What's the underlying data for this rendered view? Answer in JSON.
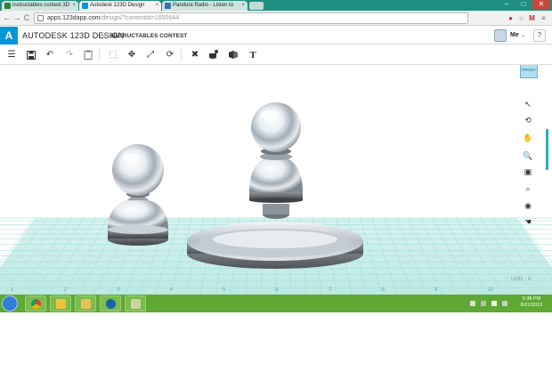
{
  "browser": {
    "tabs": [
      {
        "label": "instructables contest 3D",
        "active": false,
        "favicon_color": "#2d7f3b"
      },
      {
        "label": "Autodesk 123D Design",
        "active": true,
        "favicon_color": "#0696d7"
      },
      {
        "label": "Pandora Radio - Listen to",
        "active": false,
        "favicon_color": "#3a6fb5"
      }
    ],
    "tab_close": "×",
    "window_buttons": {
      "minimize": "–",
      "maximize": "□",
      "close": "✕"
    },
    "url_host": "apps.123dapp.com",
    "url_path": "/design/?contentId=1650644",
    "nav": {
      "back": "←",
      "forward": "→",
      "reload": "C"
    }
  },
  "app": {
    "logo_letter": "A",
    "brand_prefix": "AUTODESK",
    "brand_suffix": "123D",
    "brand_word": "DESIGN",
    "separator": "\\",
    "project_name": "INSTRUCTABLES CONTEST",
    "user_label": "Me",
    "user_caret": "⌄",
    "help_label": "?"
  },
  "toolbar": {
    "menu": "☰",
    "save": "💾",
    "undo": "↶",
    "redo": "↷",
    "paste": "📋",
    "select": "⬚",
    "move": "✥",
    "scale": "⤢",
    "rotate": "⟳",
    "tools": "✖",
    "material": "🍵",
    "group": "⬢",
    "text": "T"
  },
  "viewport": {
    "viewcube_label": "FRONT",
    "units_label": "Units : in",
    "ruler_numbers": [
      "1",
      "2",
      "3",
      "4",
      "5",
      "6",
      "7",
      "8",
      "9",
      "10"
    ],
    "grid_color": "#7fd3cc",
    "nav_tools": [
      "pointer",
      "orbit",
      "pan",
      "zoom",
      "fit",
      "zoom-window",
      "look",
      "hand"
    ]
  },
  "taskbar": {
    "time": "5:38 PM",
    "date": "8/21/2013",
    "apps": [
      "chrome",
      "mail",
      "explorer",
      "hp",
      "tool"
    ]
  }
}
